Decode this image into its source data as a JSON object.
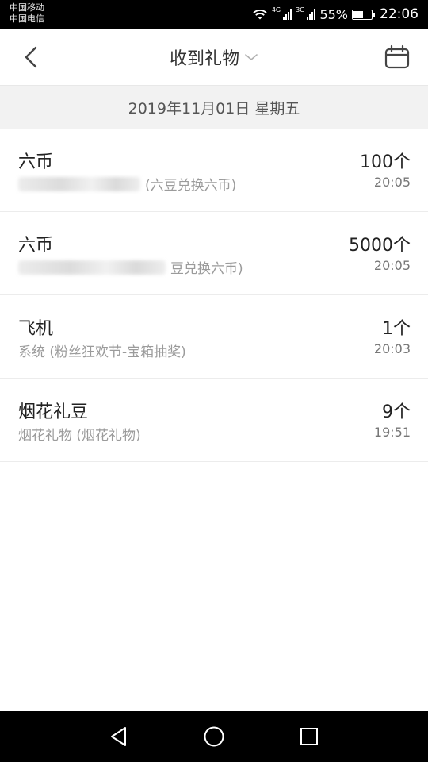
{
  "status_bar": {
    "carrier_1": "中国移动",
    "carrier_2": "中国电信",
    "network_1": "4G",
    "network_2": "3G",
    "battery_text": "55%",
    "battery_level": 0.55,
    "time": "22:06"
  },
  "header": {
    "title": "收到礼物",
    "back_icon": "back-chevron-icon",
    "dropdown_icon": "chevron-down-icon",
    "calendar_icon": "calendar-icon"
  },
  "date_bar": {
    "date": "2019年11月01日 星期五"
  },
  "gifts": [
    {
      "name": "六币",
      "source": "(六豆兑换六币)",
      "count": "100个",
      "time": "20:05"
    },
    {
      "name": "六币",
      "source": "豆兑换六币)",
      "count": "5000个",
      "time": "20:05"
    },
    {
      "name": "飞机",
      "source": "系统 (粉丝狂欢节-宝箱抽奖)",
      "count": "1个",
      "time": "20:03"
    },
    {
      "name": "烟花礼豆",
      "source": "烟花礼物 (烟花礼物)",
      "count": "9个",
      "time": "19:51"
    }
  ],
  "nav_bar": {
    "back_icon": "nav-back-triangle-icon",
    "home_icon": "nav-home-circle-icon",
    "recents_icon": "nav-recents-square-icon"
  },
  "colors": {
    "status_bar_bg": "#000000",
    "date_bar_bg": "#f2f2f2",
    "primary_text": "#222222",
    "secondary_text": "#9b9b9b"
  }
}
